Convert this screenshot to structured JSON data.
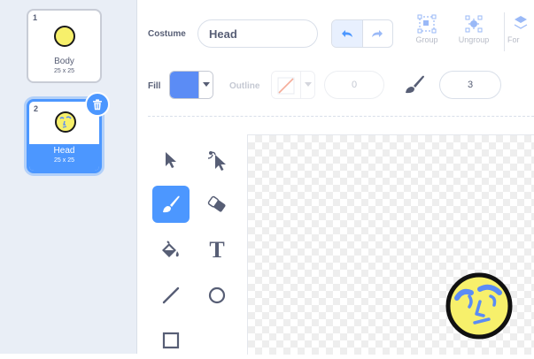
{
  "costumes": [
    {
      "number": "1",
      "name": "Body",
      "size": "25 x 25",
      "selected": false
    },
    {
      "number": "2",
      "name": "Head",
      "size": "25 x 25",
      "selected": true
    }
  ],
  "toolbar": {
    "costume_label": "Costume",
    "costume_name": "Head",
    "group_label": "Group",
    "ungroup_label": "Ungroup",
    "forward_label": "For"
  },
  "style_bar": {
    "fill_label": "Fill",
    "fill_color": "#5b8cf5",
    "outline_label": "Outline",
    "outline_width": "0",
    "brush_size": "3"
  },
  "tools": [
    "select-tool",
    "reshape-tool",
    "brush-tool",
    "eraser-tool",
    "fill-tool",
    "text-tool",
    "line-tool",
    "circle-tool",
    "rectangle-tool"
  ],
  "selected_tool": "brush-tool",
  "colors": {
    "accent": "#4c97ff",
    "costume_yellow": "#f7f06b",
    "face_blue": "#5b8cf5"
  },
  "canvas_text_tool_glyph": "T"
}
